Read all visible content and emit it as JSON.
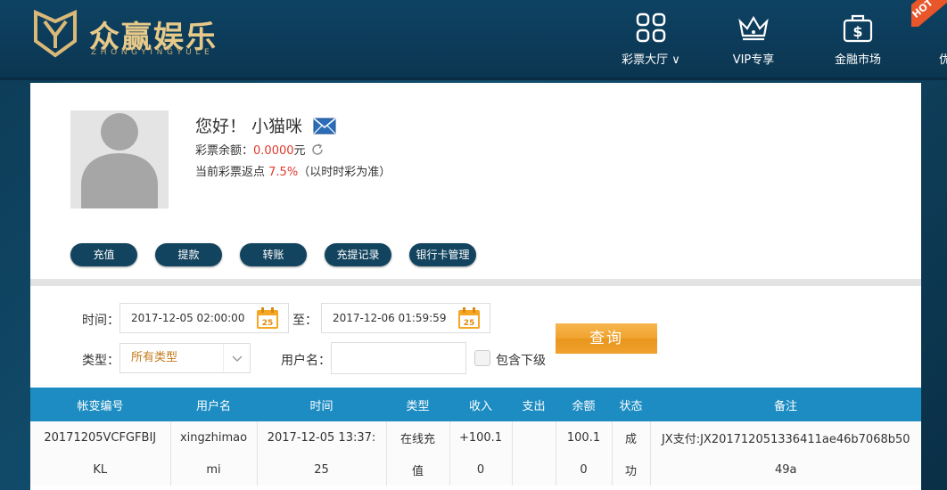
{
  "brand": {
    "title": "众赢娱乐",
    "subtitle": "ZHONGYINGYULE"
  },
  "nav": [
    {
      "label": "彩票大厅 ∨",
      "icon": "grid-icon"
    },
    {
      "label": "VIP专享",
      "icon": "crown-icon"
    },
    {
      "label": "金融市场",
      "icon": "money-bag-icon"
    },
    {
      "label": "优惠活动",
      "icon": "star-icon"
    }
  ],
  "hot_tag": "HOT",
  "profile": {
    "greeting": "您好！ 小猫咪",
    "balance_label": "彩票余额：",
    "balance_value": "0.0000",
    "balance_unit": "元",
    "rebate_label": "当前彩票返点",
    "rebate_value": "7.5%",
    "rebate_note": "（以时时彩为准）"
  },
  "actions": [
    "充值",
    "提款",
    "转账",
    "充提记录",
    "银行卡管理"
  ],
  "filter": {
    "time_label": "时间：",
    "start_time": "2017-12-05 02:00:00",
    "to_label": "至：",
    "end_time": "2017-12-06 01:59:59",
    "calendar_day": "25",
    "type_label": "类型：",
    "type_value": "所有类型",
    "username_label": "用户名：",
    "include_sub_label": "包含下级",
    "query_label": "查询"
  },
  "table": {
    "headers": [
      "帐变编号",
      "用户名",
      "时间",
      "类型",
      "收入",
      "支出",
      "余额",
      "状态",
      "备注"
    ],
    "rows": [
      [
        "20171205VCFGFBIJ",
        "xingzhimao",
        "2017-12-05 13:37:",
        "在线充",
        "+100.1",
        "",
        "100.1",
        "成",
        "JX支付:JX201712051336411ae46b7068b50"
      ],
      [
        "KL",
        "mi",
        "25",
        "值",
        "0",
        "",
        "0",
        "功",
        "49a"
      ]
    ]
  },
  "colors": {
    "header_bg": "#0e4263",
    "accent_orange": "#f0a22e",
    "table_header": "#1c8cc2",
    "pill_bg": "#13445f",
    "red": "#e03a2e"
  }
}
